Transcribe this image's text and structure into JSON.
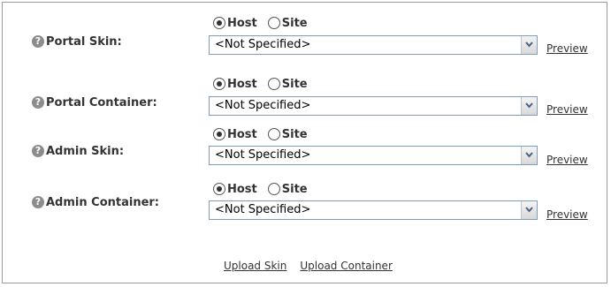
{
  "options": {
    "host_label": "Host",
    "site_label": "Site",
    "preview_label": "Preview"
  },
  "rows": [
    {
      "label": "Portal Skin:",
      "selected": "host",
      "value": "<Not Specified>"
    },
    {
      "label": "Portal Container:",
      "selected": "host",
      "value": "<Not Specified>"
    },
    {
      "label": "Admin Skin:",
      "selected": "host",
      "value": "<Not Specified>"
    },
    {
      "label": "Admin Container:",
      "selected": "host",
      "value": "<Not Specified>"
    }
  ],
  "footer": {
    "upload_skin": "Upload Skin",
    "upload_container": "Upload Container"
  }
}
